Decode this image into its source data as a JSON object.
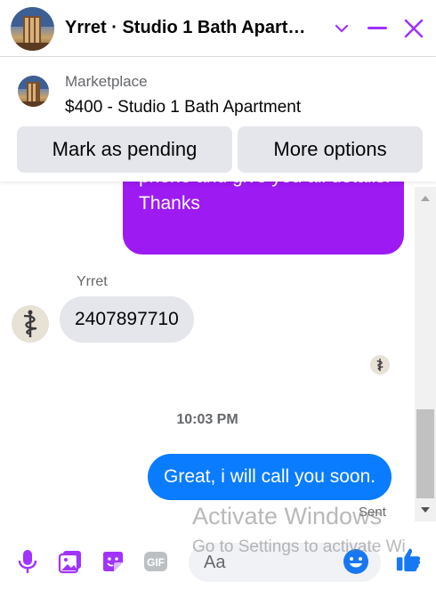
{
  "header": {
    "title": "Yrret · Studio 1 Bath Apart…",
    "icons": [
      "chevron-down-icon",
      "minimize-icon",
      "close-icon"
    ],
    "accent_color": "#a033ff"
  },
  "marketplace": {
    "label": "Marketplace",
    "listing": "$400 - Studio 1 Bath Apartment",
    "buttons": {
      "pending": "Mark as pending",
      "more": "More options"
    }
  },
  "messages": {
    "outgoing_1": {
      "text": "phone and give you all details. Thanks",
      "color": "#9d1bf2"
    },
    "incoming": {
      "sender": "Yrret",
      "text": "2407897710"
    },
    "timestamp": "10:03 PM",
    "outgoing_2": {
      "text": "Great, i will call you soon.",
      "color": "#0a7cff",
      "status": "Sent"
    }
  },
  "composer": {
    "placeholder": "Aa",
    "icons": [
      "microphone-icon",
      "photo-icon",
      "sticker-icon",
      "gif-icon",
      "emoji-icon",
      "like-icon"
    ],
    "gif_label": "GIF"
  },
  "watermark": {
    "line1": "Activate Windows",
    "line2": "Go to Settings to activate Wi"
  }
}
